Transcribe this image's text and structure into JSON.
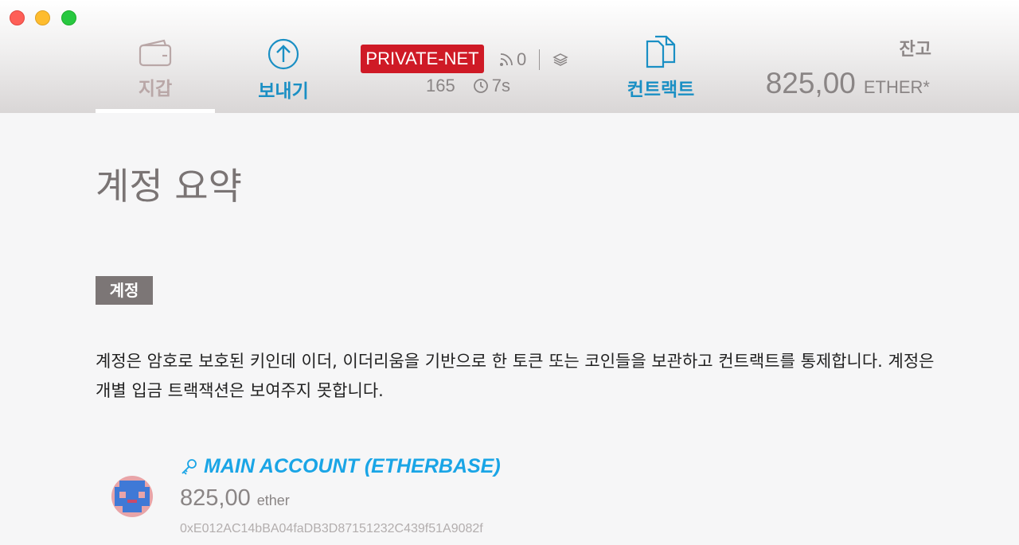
{
  "nav": {
    "wallet_label": "지갑",
    "send_label": "보내기",
    "contracts_label": "컨트랙트"
  },
  "network": {
    "badge": "PRIVATE-NET",
    "peers": "0",
    "block_number": "165",
    "block_time": "7s"
  },
  "balance": {
    "label": "잔고",
    "amount": "825,00",
    "unit": "ETHER*"
  },
  "page": {
    "title": "계정 요약",
    "section_tag": "계정",
    "description": "계정은 암호로 보호된 키인데 이더, 이더리움을 기반으로 한 토큰 또는 코인들을 보관하고 컨트랙트를 통제합니다. 계정은 개별 입금 트랙잭션은 보여주지 못합니다."
  },
  "account": {
    "name": "MAIN ACCOUNT (ETHERBASE)",
    "balance": "825,00",
    "unit": "ether",
    "address": "0xE012AC14bBA04faDB3D87151232C439f51A9082f"
  },
  "colors": {
    "accent_blue": "#1a8fc4",
    "link_blue": "#1aa5e6",
    "network_red": "#cf1a26",
    "tag_gray": "#7c7676"
  },
  "icons": {
    "wallet": "wallet-icon",
    "send": "arrow-up-circle-icon",
    "contracts": "documents-icon",
    "peers": "signal-icon",
    "layers": "layers-icon",
    "clock": "clock-icon",
    "key": "key-icon"
  }
}
